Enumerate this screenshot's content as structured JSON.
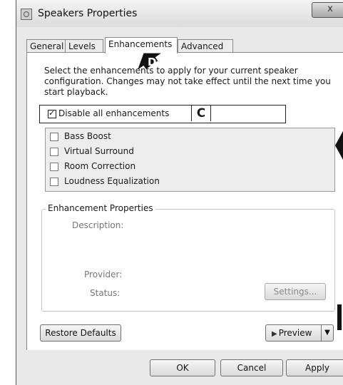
{
  "window": {
    "title": "Speakers Properties",
    "close_glyph": "x"
  },
  "tabs": [
    {
      "label": "General",
      "active": false
    },
    {
      "label": "Levels",
      "active": false
    },
    {
      "label": "Enhancements",
      "active": true
    },
    {
      "label": "Advanced",
      "active": false
    }
  ],
  "enhancements_tab": {
    "intro": "Select the enhancements to apply for your current speaker configuration. Changes may not take effect until the next time you start playback.",
    "disable_all": {
      "label": "Disable all enhancements",
      "checked": true
    },
    "items": [
      {
        "label": "Bass Boost",
        "checked": false
      },
      {
        "label": "Virtual Surround",
        "checked": false
      },
      {
        "label": "Room Correction",
        "checked": false
      },
      {
        "label": "Loudness Equalization",
        "checked": false
      }
    ],
    "properties": {
      "legend": "Enhancement Properties",
      "description_label": "Description:",
      "provider_label": "Provider:",
      "status_label": "Status:",
      "settings_button": "Settings..."
    },
    "restore_defaults": "Restore Defaults",
    "preview_button": "Preview"
  },
  "footer": {
    "ok": "OK",
    "cancel": "Cancel",
    "apply": "Apply"
  },
  "annotations": {
    "label_c": "C",
    "label_d": "D"
  },
  "icons": {
    "window_icon": "speaker-properties-icon",
    "preview": "play-triangle-icon",
    "preview_menu": "chevron-down-icon"
  }
}
